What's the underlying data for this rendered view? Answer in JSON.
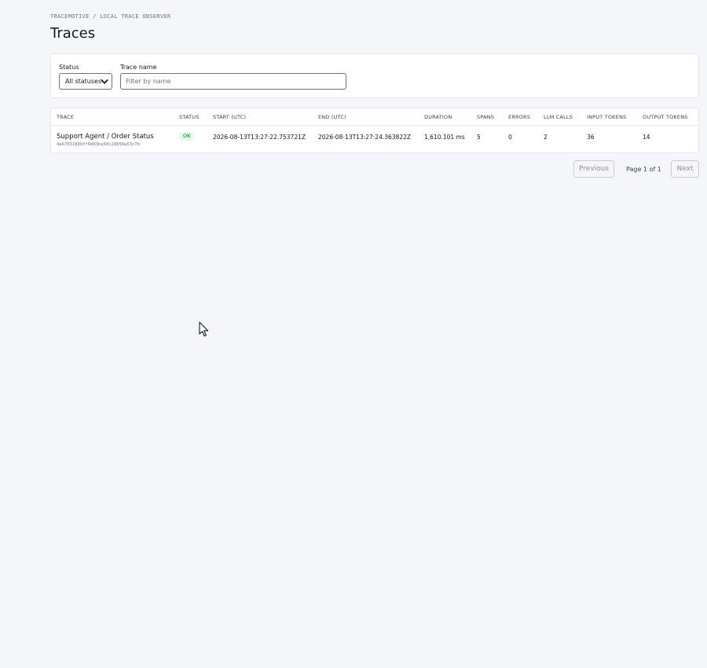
{
  "breadcrumb": "TRACEMOTIVE / LOCAL TRACE OBSERVER",
  "title": "Traces",
  "filters": {
    "status_label": "Status",
    "status_value": "All statuses",
    "name_label": "Trace name",
    "name_placeholder": "Filter by name"
  },
  "table": {
    "columns": [
      "TRACE",
      "STATUS",
      "START (UTC)",
      "END (UTC)",
      "DURATION",
      "SPANS",
      "ERRORS",
      "LLM CALLS",
      "INPUT TOKENS",
      "OUTPUT TOKENS"
    ],
    "rows": [
      {
        "name": "Support Agent / Order Status",
        "id": "4a67631889ff6893ba50c28858a53c7b",
        "status": "OK",
        "start": "2026-08-13T13:27:22.753721Z",
        "end": "2026-08-13T13:27:24.363822Z",
        "duration": "1,610.101 ms",
        "spans": "5",
        "errors": "0",
        "llm_calls": "2",
        "input_tokens": "36",
        "output_tokens": "14"
      }
    ]
  },
  "pagination": {
    "previous": "Previous",
    "info": "Page 1 of 1",
    "next": "Next"
  },
  "colors": {
    "background": "#f5f6fa",
    "ok_badge_bg": "#dcfce7",
    "ok_badge_text": "#166534"
  }
}
